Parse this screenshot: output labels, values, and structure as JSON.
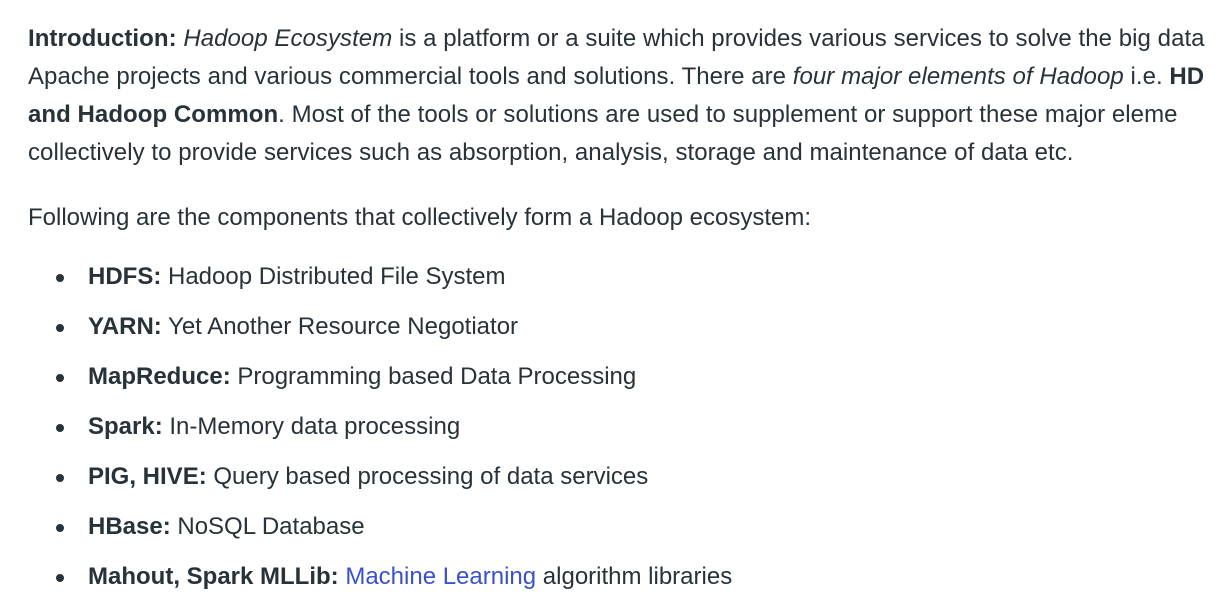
{
  "intro": {
    "label": "Introduction:",
    "term": "Hadoop Ecosystem",
    "text_1": " is a platform or a suite which provides various services to solve the big data",
    "text_2": "Apache projects and various commercial tools and solutions. There are ",
    "phrase": "four major elements of Hadoop",
    "text_3": " i.e. ",
    "strong_1": "HD",
    "strong_2": "and Hadoop Common",
    "text_4": ". Most of the tools or solutions are used to supplement or support these major eleme",
    "text_5": "collectively to provide services such as absorption, analysis, storage and maintenance of data etc."
  },
  "following": "Following are the components that collectively form a Hadoop ecosystem:",
  "components": [
    {
      "name": "HDFS:",
      "desc": " Hadoop Distributed File System"
    },
    {
      "name": "YARN:",
      "desc": " Yet Another Resource Negotiator"
    },
    {
      "name": "MapReduce:",
      "desc": " Programming based Data Processing"
    },
    {
      "name": "Spark:",
      "desc": " In-Memory data processing"
    },
    {
      "name": "PIG, HIVE:",
      "desc": " Query based processing of data services"
    },
    {
      "name": "HBase:",
      "desc": " NoSQL Database"
    },
    {
      "name": "Mahout, Spark MLLib:",
      "link": "Machine Learning",
      "desc": " algorithm libraries"
    }
  ],
  "colors": {
    "text": "#273239",
    "link": "#3a51c9",
    "background": "#ffffff"
  }
}
